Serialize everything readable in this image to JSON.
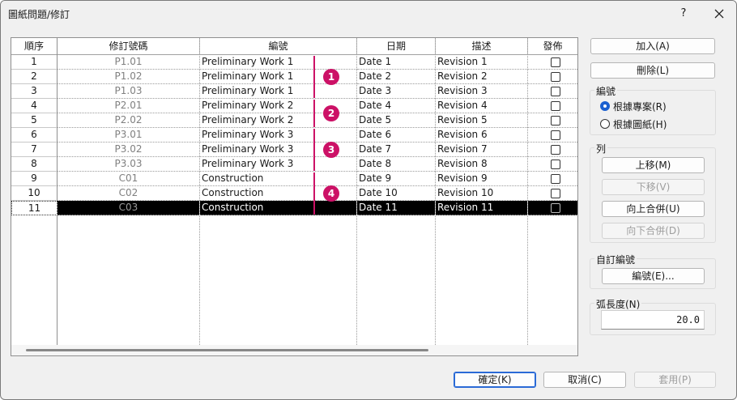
{
  "window": {
    "title": "圖紙問題/修訂",
    "help_label": "?"
  },
  "table": {
    "headers": {
      "seq": "順序",
      "number": "修訂號碼",
      "numbering": "編號",
      "date": "日期",
      "description": "描述",
      "issued": "發佈"
    },
    "rows": [
      {
        "seq": "1",
        "number": "P1.01",
        "numbering": "Preliminary Work 1",
        "date": "Date 1",
        "description": "Revision 1",
        "issued": false
      },
      {
        "seq": "2",
        "number": "P1.02",
        "numbering": "Preliminary Work 1",
        "date": "Date 2",
        "description": "Revision 2",
        "issued": false
      },
      {
        "seq": "3",
        "number": "P1.03",
        "numbering": "Preliminary Work 1",
        "date": "Date 3",
        "description": "Revision 3",
        "issued": false
      },
      {
        "seq": "4",
        "number": "P2.01",
        "numbering": "Preliminary Work 2",
        "date": "Date 4",
        "description": "Revision 4",
        "issued": false
      },
      {
        "seq": "5",
        "number": "P2.02",
        "numbering": "Preliminary Work 2",
        "date": "Date 5",
        "description": "Revision 5",
        "issued": false
      },
      {
        "seq": "6",
        "number": "P3.01",
        "numbering": "Preliminary Work 3",
        "date": "Date 6",
        "description": "Revision 6",
        "issued": false
      },
      {
        "seq": "7",
        "number": "P3.02",
        "numbering": "Preliminary Work 3",
        "date": "Date 7",
        "description": "Revision 7",
        "issued": false
      },
      {
        "seq": "8",
        "number": "P3.03",
        "numbering": "Preliminary Work 3",
        "date": "Date 8",
        "description": "Revision 8",
        "issued": false
      },
      {
        "seq": "9",
        "number": "C01",
        "numbering": "Construction",
        "date": "Date 9",
        "description": "Revision 9",
        "issued": false
      },
      {
        "seq": "10",
        "number": "C02",
        "numbering": "Construction",
        "date": "Date 10",
        "description": "Revision 10",
        "issued": false
      },
      {
        "seq": "11",
        "number": "C03",
        "numbering": "Construction",
        "date": "Date 11",
        "description": "Revision 11",
        "issued": false
      }
    ],
    "selected_row_seq": "11"
  },
  "callouts": [
    {
      "label": "1",
      "first_row": 0,
      "last_row": 2
    },
    {
      "label": "2",
      "first_row": 3,
      "last_row": 4
    },
    {
      "label": "3",
      "first_row": 5,
      "last_row": 7
    },
    {
      "label": "4",
      "first_row": 8,
      "last_row": 10
    }
  ],
  "callout_color": "#cc1166",
  "side": {
    "add_label": "加入(A)",
    "delete_label": "刪除(L)",
    "numbering_group": "編號",
    "radio_per_project": "根據專案(R)",
    "radio_per_sheet": "根據圖紙(H)",
    "radio_selected": "per_project",
    "row_group": "列",
    "move_up": "上移(M)",
    "move_down": "下移(V)",
    "merge_up": "向上合併(U)",
    "merge_down": "向下合併(D)",
    "custom_group": "自訂編號",
    "numbering_btn": "編號(E)...",
    "arc_group": "弧長度(N)",
    "arc_value": "20.0"
  },
  "footer": {
    "ok": "確定(K)",
    "cancel": "取消(C)",
    "apply": "套用(P)"
  }
}
